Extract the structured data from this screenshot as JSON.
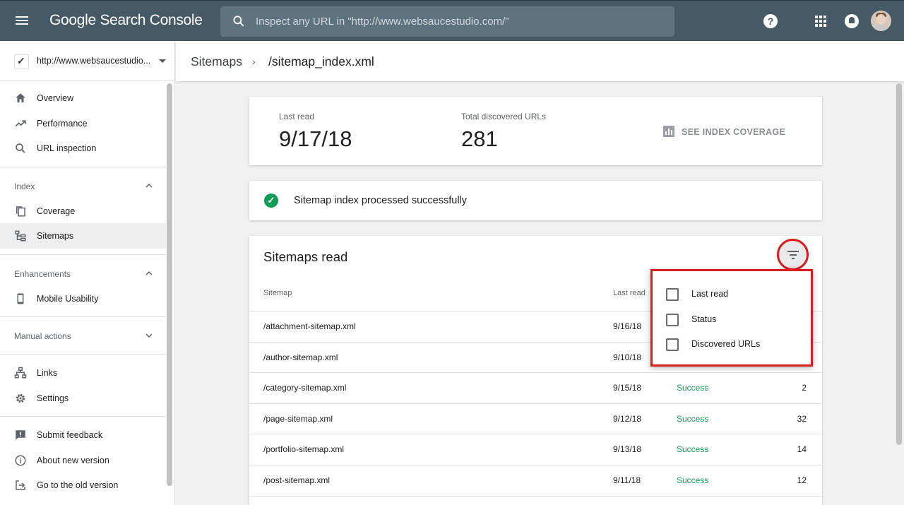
{
  "app": {
    "title": "Google Search Console"
  },
  "search": {
    "placeholder": "Inspect any URL in \"http://www.websaucestudio.com/\""
  },
  "topbar": {
    "help_glyph": "?"
  },
  "property": {
    "url": "http://www.websaucestudio...."
  },
  "sidebar": {
    "top_items": [
      {
        "label": "Overview",
        "icon": "home-icon"
      },
      {
        "label": "Performance",
        "icon": "trending-up-icon"
      },
      {
        "label": "URL inspection",
        "icon": "search-icon"
      }
    ],
    "index_section": {
      "label": "Index"
    },
    "index_items": [
      {
        "label": "Coverage",
        "icon": "coverage-icon"
      },
      {
        "label": "Sitemaps",
        "icon": "sitemap-icon"
      }
    ],
    "enhancements_section": {
      "label": "Enhancements"
    },
    "enhancements_items": [
      {
        "label": "Mobile Usability",
        "icon": "phone-icon"
      }
    ],
    "manual_section": {
      "label": "Manual actions"
    },
    "bottom_items": [
      {
        "label": "Links",
        "icon": "links-icon"
      },
      {
        "label": "Settings",
        "icon": "gear-icon"
      }
    ],
    "footer_items": [
      {
        "label": "Submit feedback",
        "icon": "feedback-icon"
      },
      {
        "label": "About new version",
        "icon": "info-icon"
      },
      {
        "label": "Go to the old version",
        "icon": "exit-icon"
      }
    ]
  },
  "breadcrumb": {
    "parent": "Sitemaps",
    "separator": "›",
    "current": "/sitemap_index.xml"
  },
  "stats": {
    "last_read_label": "Last read",
    "last_read_value": "9/17/18",
    "total_label": "Total discovered URLs",
    "total_value": "281",
    "coverage_link": "SEE INDEX COVERAGE"
  },
  "status": {
    "check_glyph": "✓",
    "message": "Sitemap index processed successfully"
  },
  "table": {
    "title": "Sitemaps read",
    "columns": {
      "sitemap": "Sitemap",
      "last_read": "Last read"
    },
    "rows": [
      {
        "sitemap": "/attachment-sitemap.xml",
        "last_read": "9/16/18",
        "status": "",
        "urls": ""
      },
      {
        "sitemap": "/author-sitemap.xml",
        "last_read": "9/10/18",
        "status": "",
        "urls": ""
      },
      {
        "sitemap": "/category-sitemap.xml",
        "last_read": "9/15/18",
        "status": "Success",
        "urls": "2"
      },
      {
        "sitemap": "/page-sitemap.xml",
        "last_read": "9/12/18",
        "status": "Success",
        "urls": "32"
      },
      {
        "sitemap": "/portfolio-sitemap.xml",
        "last_read": "9/13/18",
        "status": "Success",
        "urls": "14"
      },
      {
        "sitemap": "/post-sitemap.xml",
        "last_read": "9/11/18",
        "status": "Success",
        "urls": "12"
      }
    ]
  },
  "filter_menu": {
    "options": [
      {
        "label": "Last read",
        "checked": false
      },
      {
        "label": "Status",
        "checked": false
      },
      {
        "label": "Discovered URLs",
        "checked": false
      }
    ]
  },
  "colors": {
    "topbar": "#455a64",
    "success": "#0f9d58",
    "highlight": "#d91c1c"
  }
}
